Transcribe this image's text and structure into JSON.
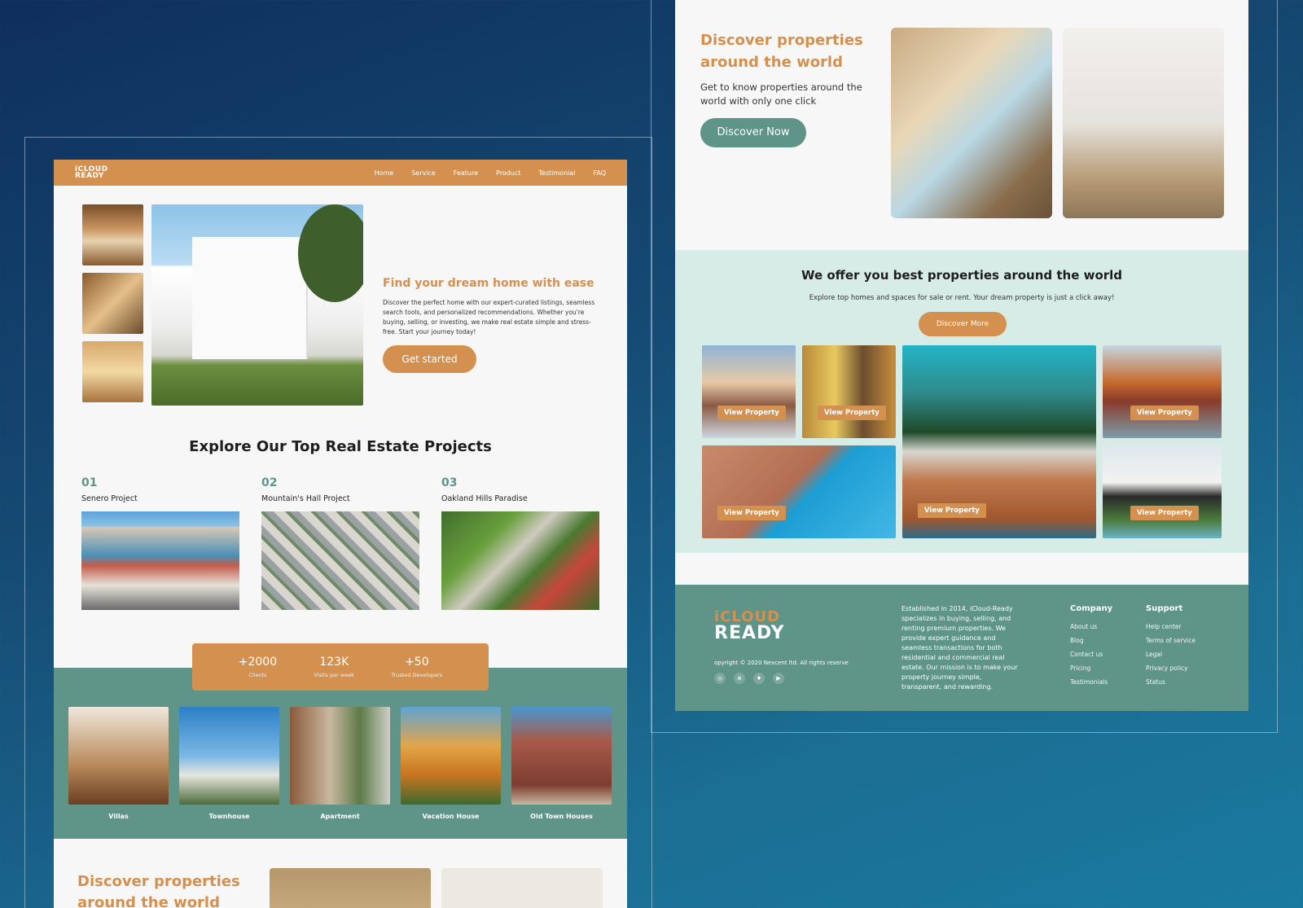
{
  "colors": {
    "accent": "#d4904e",
    "teal": "#5f9488",
    "mint": "#d8ece7",
    "background_top": "#0f2f5e",
    "background_bottom": "#1a7aa0"
  },
  "left_page": {
    "logo": {
      "line1": "iCLOUD",
      "line2": "READY"
    },
    "nav": [
      "Home",
      "Service",
      "Feature",
      "Product",
      "Testimonial",
      "FAQ"
    ],
    "hero": {
      "title": "Find your dream home with ease",
      "description": "Discover the perfect home with our expert-curated listings, seamless search tools, and personalized recommendations. Whether you're buying, selling, or investing, we make real estate simple and stress-free. Start your journey today!",
      "cta": "Get started"
    },
    "projects": {
      "title": "Explore Our Top Real Estate Projects",
      "items": [
        {
          "number": "01",
          "name": "Senero Project"
        },
        {
          "number": "02",
          "name": "Mountain's Hall Project"
        },
        {
          "number": "03",
          "name": "Oakland Hills Paradise"
        }
      ]
    },
    "stats": [
      {
        "value": "+2000",
        "label": "Clients"
      },
      {
        "value": "123K",
        "label": "Visits per week"
      },
      {
        "value": "+50",
        "label": "Trusted Developers"
      }
    ],
    "property_types": [
      "Villas",
      "Townhouse",
      "Apartment",
      "Vacation House",
      "Old Town Houses"
    ],
    "discover_title": "Discover properties around the world"
  },
  "right_page": {
    "discover": {
      "title": "Discover properties around the world",
      "description": "Get to know properties around the world with only one click",
      "cta": "Discover Now"
    },
    "offer": {
      "title": "We offer you best properties around the world",
      "description": "Explore top homes and spaces for sale or rent. Your dream property is just a click away!",
      "cta": "Discover More",
      "view_label": "View Property"
    },
    "footer": {
      "logo": {
        "line1": "iCLOUD",
        "line2": "READY"
      },
      "copyright": "opyright © 2020 Nexcent ltd.  All rights reserve",
      "socials": [
        "instagram-icon",
        "dribbble-icon",
        "twitter-icon",
        "youtube-icon"
      ],
      "about": "Established in 2014, iCloud-Ready specializes in buying, selling, and renting premium properties. We provide expert guidance and seamless transactions for both residential and commercial real estate. Our mission is to make your property journey simple, transparent, and rewarding.",
      "company": {
        "title": "Company",
        "links": [
          "About us",
          "Blog",
          "Contact us",
          "Pricing",
          "Testimonials"
        ]
      },
      "support": {
        "title": "Support",
        "links": [
          "Help center",
          "Terms of service",
          "Legal",
          "Privacy policy",
          "Status"
        ]
      }
    }
  }
}
